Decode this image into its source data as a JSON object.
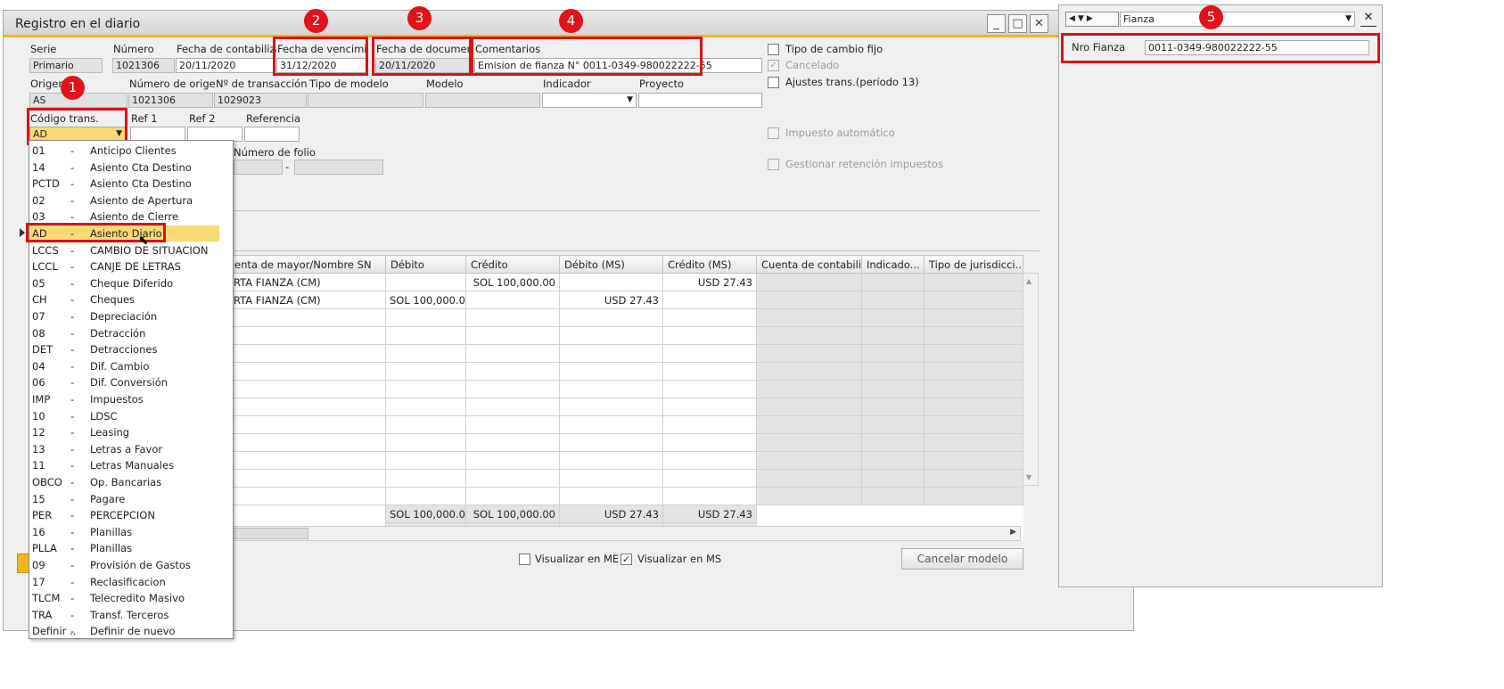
{
  "window": {
    "title": "Registro en el diario",
    "minimize": "_",
    "maximize": "□",
    "close": "✕"
  },
  "header": {
    "serie_label": "Serie",
    "serie_value": "Primario",
    "numero_label": "Número",
    "numero_value": "1021306",
    "fecha_contab_label": "Fecha de contabiliza",
    "fecha_contab_value": "20/11/2020",
    "fecha_venc_label": "Fecha de vencimie",
    "fecha_venc_value": "31/12/2020",
    "fecha_doc_label": "Fecha de document",
    "fecha_doc_value": "20/11/2020",
    "comentarios_label": "Comentarios",
    "comentarios_value": "Emision de fianza N° 0011-0349-980022222-55",
    "origen_label": "Origen",
    "origen_value": "AS",
    "num_origen_label": "Número de origer",
    "num_origen_value": "1021306",
    "num_trans_label": "Nº de transacción",
    "num_trans_value": "1029023",
    "tipo_modelo_label": "Tipo de modelo",
    "modelo_label": "Modelo",
    "indicador_label": "Indicador",
    "proyecto_label": "Proyecto",
    "codigo_trans_label": "Código trans.",
    "codigo_trans_value": "AD",
    "ref1_label": "Ref 1",
    "ref2_label": "Ref 2",
    "ref3_label": "Referencia 3",
    "num_folio_label": "Número de folio",
    "folio_dash": "-"
  },
  "options": {
    "tipo_cambio_fijo": "Tipo de cambio fijo",
    "cancelado": "Cancelado",
    "ajustes_trans": "Ajustes trans.(período 13)",
    "impuesto_auto": "Impuesto automático",
    "gestionar_ret": "Gestionar retención impuestos"
  },
  "dropdown_items": [
    {
      "code": "01",
      "name": "Anticipo Clientes"
    },
    {
      "code": "14",
      "name": "Asiento Cta Destino"
    },
    {
      "code": "PCTD",
      "name": "Asiento Cta Destino"
    },
    {
      "code": "02",
      "name": "Asiento de Apertura"
    },
    {
      "code": "03",
      "name": "Asiento de Cierre"
    },
    {
      "code": "AD",
      "name": "Asiento Diario"
    },
    {
      "code": "LCCS",
      "name": "CAMBIO DE SITUACION"
    },
    {
      "code": "LCCL",
      "name": "CANJE DE LETRAS"
    },
    {
      "code": "05",
      "name": "Cheque Diferido"
    },
    {
      "code": "CH",
      "name": "Cheques"
    },
    {
      "code": "07",
      "name": "Depreciación"
    },
    {
      "code": "08",
      "name": "Detracción"
    },
    {
      "code": "DET",
      "name": "Detracciones"
    },
    {
      "code": "04",
      "name": "Dif. Cambio"
    },
    {
      "code": "06",
      "name": "Dif. Conversión"
    },
    {
      "code": "IMP",
      "name": "Impuestos"
    },
    {
      "code": "10",
      "name": "LDSC"
    },
    {
      "code": "12",
      "name": "Leasing"
    },
    {
      "code": "13",
      "name": "Letras a Favor"
    },
    {
      "code": "11",
      "name": "Letras Manuales"
    },
    {
      "code": "OBCO",
      "name": "Op. Bancarias"
    },
    {
      "code": "15",
      "name": "Pagare"
    },
    {
      "code": "PER",
      "name": "PERCEPCION"
    },
    {
      "code": "16",
      "name": "Planillas"
    },
    {
      "code": "PLLA",
      "name": "Planillas"
    },
    {
      "code": "09",
      "name": "Provisión de Gastos"
    },
    {
      "code": "17",
      "name": "Reclasificacion"
    },
    {
      "code": "TLCM",
      "name": "Telecredito Masivo"
    },
    {
      "code": "TRA",
      "name": "Transf. Terceros"
    },
    {
      "code": "Definir ..",
      "name": "Definir de nuevo"
    }
  ],
  "dropdown_dash": "-",
  "grid": {
    "columns": [
      "enta de mayor/Nombre SN",
      "Débito",
      "Crédito",
      "Débito (MS)",
      "Crédito (MS)",
      "Cuenta de contabili...",
      "Indicado...",
      "Tipo de jurisdicci..."
    ],
    "rows": [
      [
        "RTA FIANZA (CM)",
        "",
        "SOL 100,000.00",
        "",
        "USD 27.43",
        "",
        "",
        ""
      ],
      [
        "RTA FIANZA (CM)",
        "SOL 100,000.00",
        "",
        "USD 27.43",
        "",
        "",
        "",
        ""
      ]
    ],
    "empty_rows": 11,
    "totals": [
      "",
      "SOL 100,000.00",
      "SOL 100,000.00",
      "USD 27.43",
      "USD 27.43"
    ]
  },
  "footer": {
    "visualizar_me": "Visualizar en ME",
    "visualizar_ms": "Visualizar en MS",
    "cancelar_modelo": "Cancelar modelo"
  },
  "udf_panel": {
    "category": "Fianza",
    "field_label": "Nro Fianza",
    "field_value": "0011-0349-980022222-55",
    "close": "✕"
  },
  "markers": [
    "1",
    "2",
    "3",
    "4",
    "5"
  ],
  "colors": {
    "accent": "#f3b51a",
    "highlight": "#fbd975",
    "marker": "#d9121b"
  }
}
